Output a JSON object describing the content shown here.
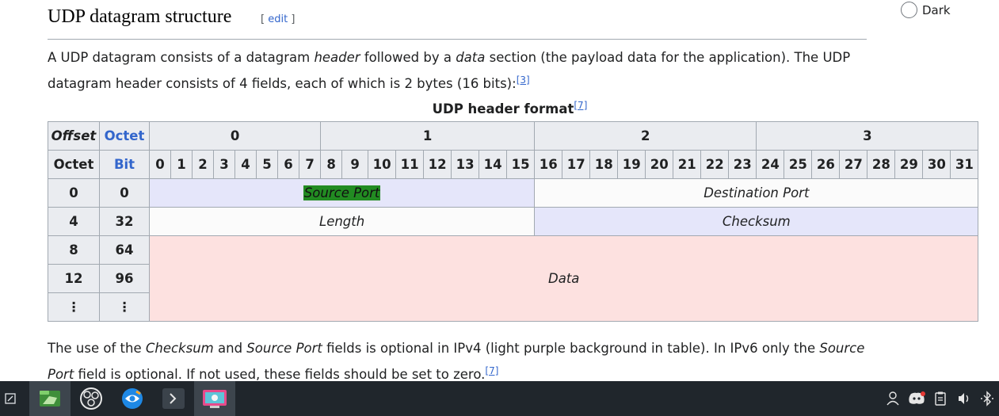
{
  "section": {
    "title": "UDP datagram structure",
    "edit_open": "[ ",
    "edit_label": "edit",
    "edit_close": " ]"
  },
  "theme_option": {
    "label": "Dark"
  },
  "intro": {
    "l1a": "A UDP datagram consists of a datagram ",
    "l1b": "header",
    "l1c": " followed by a ",
    "l1d": "data",
    "l1e": " section (the payload data for the application). The UDP",
    "l2a": "datagram header consists of 4 fields, each of which is 2 bytes (16 bits):",
    "l2ref": "[3]"
  },
  "caption": {
    "text": "UDP header format",
    "ref": "[7]"
  },
  "header_table": {
    "h_offset": "Offset",
    "h_octet": "Octet",
    "h_octet2": "Octet",
    "h_bit": "Bit",
    "octets": [
      "0",
      "1",
      "2",
      "3"
    ],
    "bits": [
      "0",
      "1",
      "2",
      "3",
      "4",
      "5",
      "6",
      "7",
      "8",
      "9",
      "10",
      "11",
      "12",
      "13",
      "14",
      "15",
      "16",
      "17",
      "18",
      "19",
      "20",
      "21",
      "22",
      "23",
      "24",
      "25",
      "26",
      "27",
      "28",
      "29",
      "30",
      "31"
    ],
    "rows": [
      {
        "octet": "0",
        "bit": "0"
      },
      {
        "octet": "4",
        "bit": "32"
      },
      {
        "octet": "8",
        "bit": "64"
      },
      {
        "octet": "12",
        "bit": "96"
      },
      {
        "octet": "⋮",
        "bit": "⋮"
      }
    ],
    "fields": {
      "source_port": "Source Port",
      "destination_port": "Destination Port",
      "length": "Length",
      "checksum": "Checksum",
      "data": "Data"
    }
  },
  "footer_text": {
    "l1a": "The use of the ",
    "l1b": "Checksum",
    "l1c": " and ",
    "l1d": "Source Port",
    "l1e": " fields is optional in IPv4 (light purple background in table). In IPv6 only the ",
    "l1f": "Source",
    "l2a": "Port",
    "l2b": " field is optional. If not used, these fields should be set to zero.",
    "l2ref": "[7]"
  },
  "colors": {
    "header_bg": "#eaecf0",
    "optional_field_bg": "#e5e6fa",
    "data_bg": "#fde1e0",
    "link": "#3366cc",
    "highlight": "#228b22",
    "taskbar_bg": "#20262c"
  },
  "taskbar_icons": [
    "notes-icon",
    "file-manager-icon",
    "obs-studio-icon",
    "browser-icon",
    "terminal-icon",
    "screenshot-tool-icon"
  ],
  "tray_icons": [
    "user-icon",
    "discord-icon",
    "clipboard-icon",
    "volume-icon",
    "bluetooth-icon"
  ]
}
